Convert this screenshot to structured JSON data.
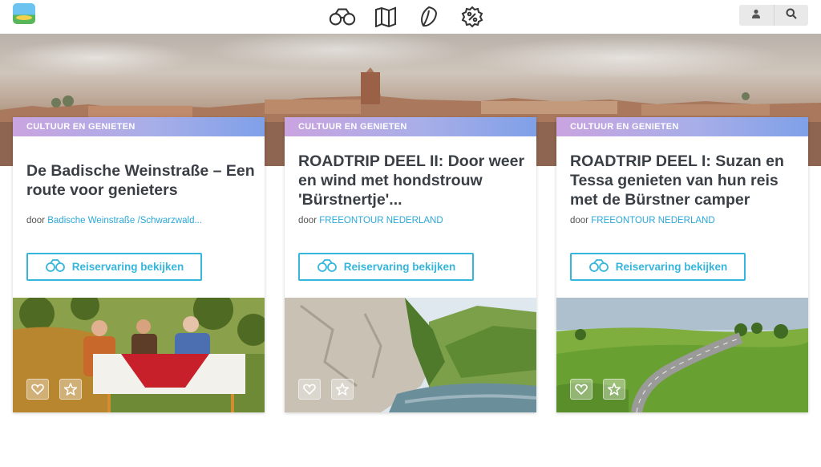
{
  "header": {
    "nav": [
      {
        "name": "binoculars-icon"
      },
      {
        "name": "map-icon"
      },
      {
        "name": "leaf-icon"
      },
      {
        "name": "percent-icon"
      }
    ],
    "tools": [
      {
        "name": "user-icon"
      },
      {
        "name": "search-icon"
      }
    ]
  },
  "colors": {
    "accent": "#36b6dd",
    "tag_from": "#c9a4e0",
    "tag_to": "#7fa0e8",
    "title": "#3a3f45"
  },
  "cards": [
    {
      "tag": "CULTUUR EN GENIETEN",
      "title": "De Badische Weinstraße – Een route voor genieters",
      "by": "door",
      "author": "Badische Weinstraße /Schwarzwald...",
      "cta": "Reiservaring bekijken",
      "photo": "dinner-in-vineyard"
    },
    {
      "tag": "CULTUUR EN GENIETEN",
      "title": "ROADTRIP DEEL II: Door weer en wind met hondstrouw 'Bürstnertje'...",
      "by": "door",
      "author": "FREEONTOUR NEDERLAND",
      "cta": "Reiservaring bekijken",
      "photo": "gorge-cliffs-river"
    },
    {
      "tag": "CULTUUR EN GENIETEN",
      "title": "ROADTRIP DEEL I: Suzan en Tessa genieten van hun reis met de Bürstner camper",
      "by": "door",
      "author": "FREEONTOUR NEDERLAND",
      "cta": "Reiservaring bekijken",
      "photo": "green-hills-road"
    }
  ]
}
